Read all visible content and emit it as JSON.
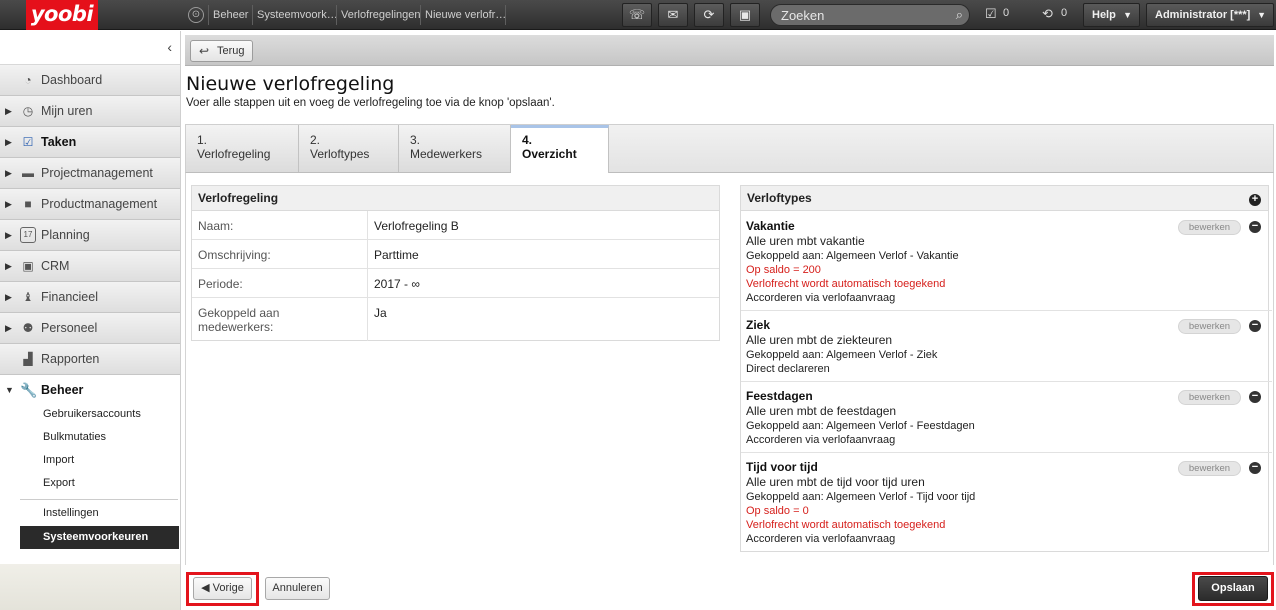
{
  "topbar": {
    "logo": "yoobi",
    "breadcrumb": [
      "Beheer",
      "Systeemvoork…",
      "Verlofregelingen",
      "Nieuwe verlofr…"
    ],
    "search_placeholder": "Zoeken",
    "tasks_count": "0",
    "sync_count": "0",
    "help_label": "Help",
    "user_label": "Administrator [***]"
  },
  "sidebar": {
    "items": [
      {
        "label": "Dashboard",
        "icon": "dashboard-icon"
      },
      {
        "label": "Mijn uren",
        "icon": "clock-icon"
      },
      {
        "label": "Taken",
        "icon": "clipboard-check-icon"
      },
      {
        "label": "Projectmanagement",
        "icon": "archive-icon"
      },
      {
        "label": "Productmanagement",
        "icon": "box-icon"
      },
      {
        "label": "Planning",
        "icon": "calendar-icon"
      },
      {
        "label": "CRM",
        "icon": "contact-card-icon"
      },
      {
        "label": "Financieel",
        "icon": "money-bag-icon"
      },
      {
        "label": "Personeel",
        "icon": "people-icon"
      },
      {
        "label": "Rapporten",
        "icon": "chart-icon"
      },
      {
        "label": "Beheer",
        "icon": "wrench-icon"
      }
    ],
    "beheer_sub": [
      "Gebruikersaccounts",
      "Bulkmutaties",
      "Import",
      "Export"
    ],
    "beheer_sub2": [
      "Instellingen",
      "Systeemvoorkeuren"
    ],
    "calendar_day": "17"
  },
  "header": {
    "back_label": "Terug",
    "title": "Nieuwe verlofregeling",
    "subtitle": "Voer alle stappen uit en voeg de verlofregeling toe via de knop 'opslaan'."
  },
  "tabs": [
    {
      "num": "1.",
      "label": "Verlofregeling"
    },
    {
      "num": "2.",
      "label": "Verloftypes"
    },
    {
      "num": "3.",
      "label": "Medewerkers"
    },
    {
      "num": "4.",
      "label": "Overzicht"
    }
  ],
  "regeling": {
    "heading": "Verlofregeling",
    "rows": [
      {
        "key": "Naam:",
        "value": "Verlofregeling B"
      },
      {
        "key": "Omschrijving:",
        "value": "Parttime"
      },
      {
        "key": "Periode:",
        "value": "2017 - ∞"
      },
      {
        "key": "Gekoppeld aan medewerkers:",
        "value": "Ja"
      }
    ]
  },
  "verloftypes": {
    "heading": "Verloftypes",
    "edit_label": "bewerken",
    "items": [
      {
        "title": "Vakantie",
        "desc": "Alle uren mbt vakantie",
        "linked": "Gekoppeld aan: Algemeen Verlof - Vakantie",
        "saldo": "Op saldo = 200",
        "auto": "Verlofrecht wordt automatisch toegekend",
        "approve": "Accorderen via verlofaanvraag"
      },
      {
        "title": "Ziek",
        "desc": "Alle uren mbt de ziekteuren",
        "linked": "Gekoppeld aan: Algemeen Verlof - Ziek",
        "approve": "Direct declareren"
      },
      {
        "title": "Feestdagen",
        "desc": "Alle uren mbt de feestdagen",
        "linked": "Gekoppeld aan: Algemeen Verlof - Feestdagen",
        "approve": "Accorderen via verlofaanvraag"
      },
      {
        "title": "Tijd voor tijd",
        "desc": "Alle uren mbt de tijd voor tijd uren",
        "linked": "Gekoppeld aan: Algemeen Verlof - Tijd voor tijd",
        "saldo": "Op saldo = 0",
        "auto": "Verlofrecht wordt automatisch toegekend",
        "approve": "Accorderen via verlofaanvraag"
      }
    ]
  },
  "footer": {
    "prev_label": "◀ Vorige",
    "cancel_label": "Annuleren",
    "save_label": "Opslaan"
  },
  "colors": {
    "brand": "#e5101a",
    "highlight": "#e3141c",
    "warning_text": "#d6201c"
  }
}
